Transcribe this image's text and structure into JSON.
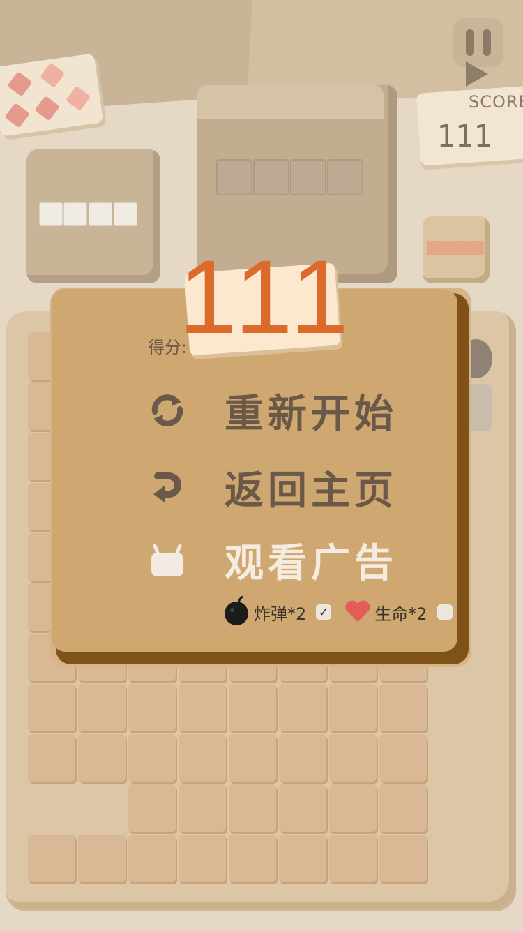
{
  "hud": {
    "score_label": "SCORE",
    "score_value": "111"
  },
  "icons": {
    "pause": "pause-icon",
    "play": "play-icon",
    "restart": "refresh-icon",
    "home": "return-arrow-icon",
    "ad": "tv-icon",
    "bomb": "bomb-icon",
    "heart": "heart-icon"
  },
  "modal": {
    "score_prefix": "得分:",
    "big_score": "111",
    "restart_label": "重新开始",
    "home_label": "返回主页",
    "ad_label": "观看广告",
    "reward_bomb": "炸弹*2",
    "reward_life": "生命*2",
    "bomb_checked": "✓",
    "life_checked": ""
  },
  "colors": {
    "accent": "#dc6a2a",
    "modal_bg": "#cfa771",
    "modal_shadow": "#7e5219",
    "heart": "#e35c58"
  }
}
